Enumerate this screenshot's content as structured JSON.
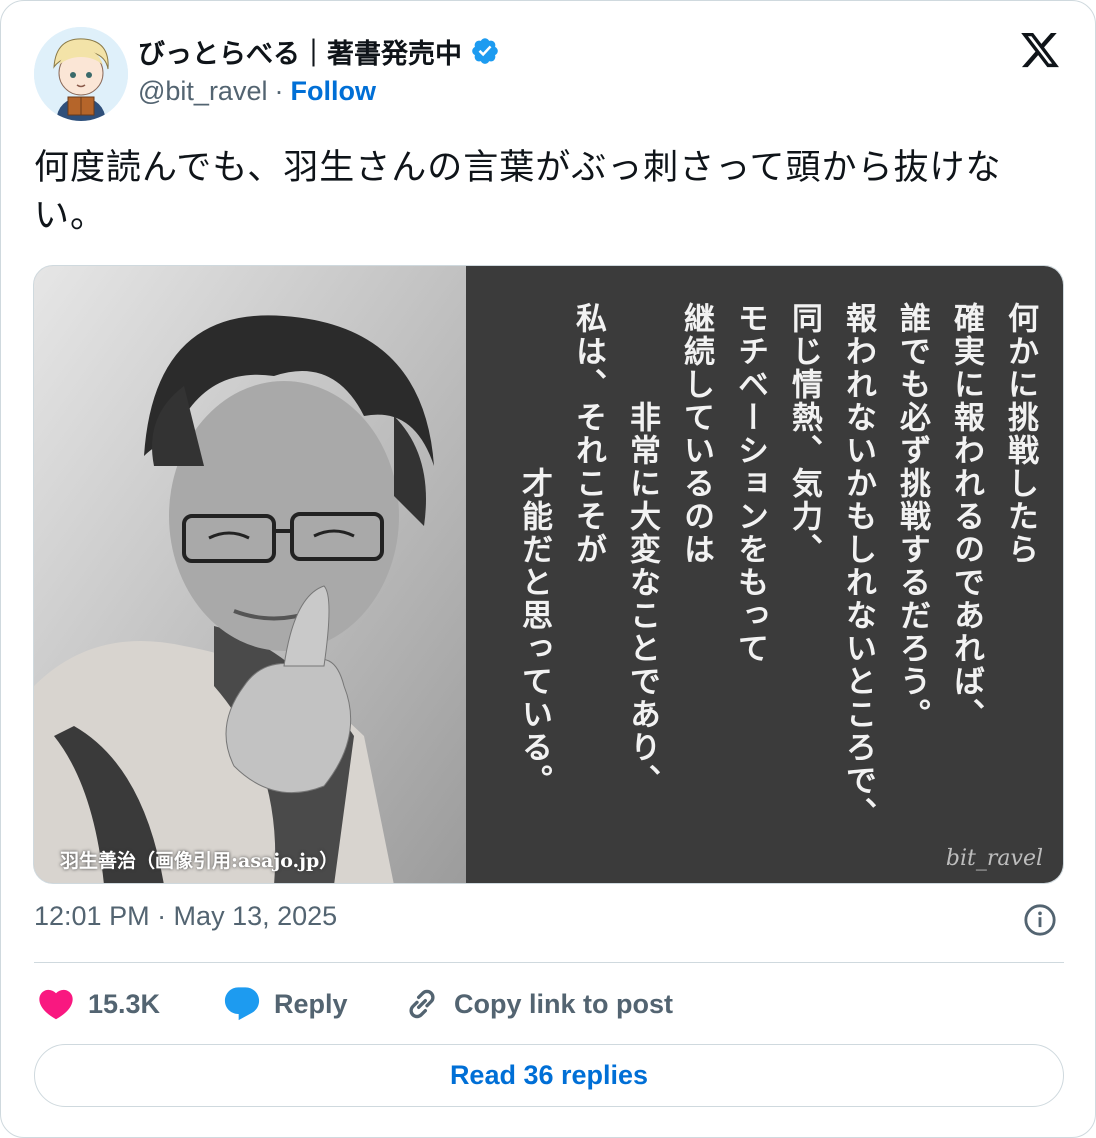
{
  "author": {
    "display_name": "びっとらべる｜著書発売中",
    "handle": "@bit_ravel",
    "separator": "·",
    "follow_label": "Follow",
    "verified": true
  },
  "tweet": {
    "text": "何度読んでも、羽生さんの言葉がぶっ刺さって頭から抜けない。",
    "timestamp": "12:01 PM · May 13, 2025"
  },
  "media": {
    "credit": "羽生善治（画像引用:asajo.jp）",
    "signature": "bit_ravel",
    "quote_lines": [
      "何かに挑戦したら",
      "確実に報われるのであれば、",
      "誰でも必ず挑戦するだろう。",
      "報われないかもしれないところで、",
      "同じ情熱、気力、",
      "モチベーションをもって",
      "継続しているのは",
      "　　　非常に大変なことであり、",
      "私は、それこそが",
      "　　　　　才能だと思っている。"
    ]
  },
  "actions": {
    "likes": "15.3K",
    "reply_label": "Reply",
    "copy_label": "Copy link to post"
  },
  "read_replies_label": "Read 36 replies",
  "colors": {
    "accent": "#006fd6",
    "verified": "#1d9bf0",
    "like": "#f91880",
    "reply": "#1d9bf0",
    "muted": "#536471",
    "border": "#cfd9de"
  },
  "icons": [
    "avatar",
    "verified-badge-icon",
    "x-logo-icon",
    "info-icon",
    "heart-icon",
    "reply-bubble-icon",
    "link-icon"
  ]
}
